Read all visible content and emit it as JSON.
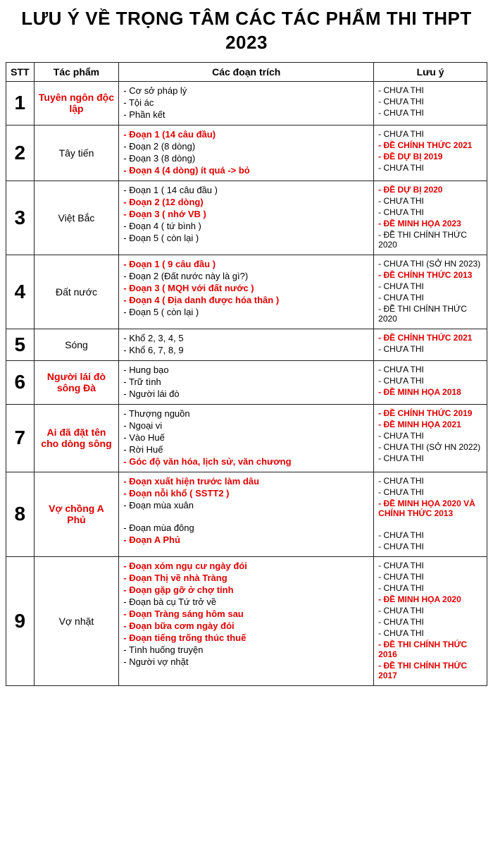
{
  "title": "LƯU Ý VỀ TRỌNG TÂM CÁC TÁC PHẨM THI THPT 2023",
  "header": {
    "stt": "STT",
    "tacpham": "Tác phẩm",
    "cac_doan_trich": "Các đoạn trích",
    "luu_y": "Lưu ý"
  },
  "rows": [
    {
      "stt": "1",
      "tacpham": "Tuyên ngôn độc lập",
      "tacpham_red": true,
      "doan": [
        {
          "text": "- Cơ sở pháp lý",
          "red": false
        },
        {
          "text": "- Tội ác",
          "red": false
        },
        {
          "text": "- Phần kết",
          "red": false
        }
      ],
      "luuy": [
        {
          "text": "- CHƯA THI",
          "red": false
        },
        {
          "text": "- CHƯA THI",
          "red": false
        },
        {
          "text": "- CHƯA THI",
          "red": false
        }
      ]
    },
    {
      "stt": "2",
      "tacpham": "Tây tiến",
      "tacpham_red": false,
      "doan": [
        {
          "text": "- Đoạn 1 (14 câu đầu)",
          "red": true
        },
        {
          "text": "- Đoạn 2 (8 dòng)",
          "red": false
        },
        {
          "text": "- Đoạn 3 (8 dòng)",
          "red": false
        },
        {
          "text": "- Đoạn 4 (4 dòng) ít quá -> bỏ",
          "red": true
        }
      ],
      "luuy": [
        {
          "text": "- CHƯA THI",
          "red": false
        },
        {
          "text": "- ĐỀ CHÍNH THỨC 2021",
          "red": true
        },
        {
          "text": "- ĐỀ DỰ BỊ 2019",
          "red": true
        },
        {
          "text": "- CHƯA THI",
          "red": false
        }
      ]
    },
    {
      "stt": "3",
      "tacpham": "Việt Bắc",
      "tacpham_red": false,
      "doan": [
        {
          "text": "- Đoạn 1 ( 14 câu đầu )",
          "red": false
        },
        {
          "text": "- Đoạn 2 (12 dòng)",
          "red": true
        },
        {
          "text": "- Đoạn 3 ( nhớ VB )",
          "red": true
        },
        {
          "text": "- Đoạn 4 ( tứ bình )",
          "red": false
        },
        {
          "text": "- Đoạn 5 ( còn lại )",
          "red": false
        }
      ],
      "luuy": [
        {
          "text": "- ĐỀ DỰ BỊ 2020",
          "red": true
        },
        {
          "text": "- CHƯA THI",
          "red": false
        },
        {
          "text": "- CHƯA THI",
          "red": false
        },
        {
          "text": "- ĐỀ MINH HỌA 2023",
          "red": true
        },
        {
          "text": "- ĐỀ THI CHÍNH THỨC 2020",
          "red": false
        }
      ]
    },
    {
      "stt": "4",
      "tacpham": "Đất nước",
      "tacpham_red": false,
      "doan": [
        {
          "text": "- Đoạn 1 ( 9 câu đầu )",
          "red": true
        },
        {
          "text": "- Đoạn 2 (Đất nước này là gì?)",
          "red": false
        },
        {
          "text": "- Đoạn 3 ( MQH với đất nước )",
          "red": true
        },
        {
          "text": "- Đoạn 4 ( Địa danh được hóa thân )",
          "red": true
        },
        {
          "text": "- Đoạn 5 ( còn lại )",
          "red": false
        }
      ],
      "luuy": [
        {
          "text": "- CHƯA THI (SỞ HN 2023)",
          "red": false
        },
        {
          "text": "- ĐỀ CHÍNH THỨC 2013",
          "red": true
        },
        {
          "text": "- CHƯA THI",
          "red": false
        },
        {
          "text": "- CHƯA THI",
          "red": false
        },
        {
          "text": "- ĐỀ THI CHÍNH THỨC 2020",
          "red": false
        }
      ]
    },
    {
      "stt": "5",
      "tacpham": "Sóng",
      "tacpham_red": false,
      "doan": [
        {
          "text": "- Khổ 2, 3, 4, 5",
          "red": false
        },
        {
          "text": "- Khổ 6, 7, 8, 9",
          "red": false
        }
      ],
      "luuy": [
        {
          "text": "- ĐỀ CHÍNH THỨC 2021",
          "red": true
        },
        {
          "text": "- CHƯA THI",
          "red": false
        }
      ]
    },
    {
      "stt": "6",
      "tacpham": "Người lái đò sông Đà",
      "tacpham_red": true,
      "doan": [
        {
          "text": "- Hung bạo",
          "red": false
        },
        {
          "text": "- Trữ tình",
          "red": false
        },
        {
          "text": "- Người lái đò",
          "red": false
        }
      ],
      "luuy": [
        {
          "text": "- CHƯA THI",
          "red": false
        },
        {
          "text": "- CHƯA THI",
          "red": false
        },
        {
          "text": "- ĐỀ MINH HỌA 2018",
          "red": true
        }
      ]
    },
    {
      "stt": "7",
      "tacpham": "Ai đã đặt tên cho dòng sông",
      "tacpham_red": true,
      "doan": [
        {
          "text": "- Thượng nguồn",
          "red": false
        },
        {
          "text": "- Ngoại vi",
          "red": false
        },
        {
          "text": "- Vào Huế",
          "red": false
        },
        {
          "text": "- Rời Huế",
          "red": false
        },
        {
          "text": "- Góc độ văn hóa, lịch sử, văn chương",
          "red": true
        }
      ],
      "luuy": [
        {
          "text": "- ĐỀ CHÍNH THỨC 2019",
          "red": true
        },
        {
          "text": "- ĐỀ MINH HỌA 2021",
          "red": true
        },
        {
          "text": "- CHƯA THI",
          "red": false
        },
        {
          "text": "- CHƯA THI (SỞ HN 2022)",
          "red": false
        },
        {
          "text": "- CHƯA THI",
          "red": false
        }
      ]
    },
    {
      "stt": "8",
      "tacpham": "Vợ chồng A Phủ",
      "tacpham_red": true,
      "doan": [
        {
          "text": "- Đoạn xuất hiện trước làm dâu",
          "red": true
        },
        {
          "text": "- Đoạn nỗi khổ ( SSTT2 )",
          "red": true
        },
        {
          "text": "- Đoạn mùa xuân",
          "red": false
        },
        {
          "text": "",
          "red": false
        },
        {
          "text": "- Đoạn mùa đông",
          "red": false
        },
        {
          "text": "- Đoạn A Phủ",
          "red": true
        }
      ],
      "luuy": [
        {
          "text": "- CHƯA THI",
          "red": false
        },
        {
          "text": "- CHƯA THI",
          "red": false
        },
        {
          "text": "- ĐỀ MINH HỌA 2020 VÀ CHÍNH THỨC 2013",
          "red": true
        },
        {
          "text": "",
          "red": false
        },
        {
          "text": "- CHƯA THI",
          "red": false
        },
        {
          "text": "- CHƯA THI",
          "red": false
        }
      ]
    },
    {
      "stt": "9",
      "tacpham": "Vợ nhặt",
      "tacpham_red": false,
      "doan": [
        {
          "text": "- Đoạn xóm ngụ cư ngày đói",
          "red": true
        },
        {
          "text": "- Đoạn Thị về nhà Tràng",
          "red": true
        },
        {
          "text": "- Đoạn gặp gỡ ở chợ tỉnh",
          "red": true
        },
        {
          "text": "- Đoạn bà cụ Tứ trở về",
          "red": false
        },
        {
          "text": "- Đoạn Tràng sáng hôm sau",
          "red": true
        },
        {
          "text": "- Đoạn bữa cơm ngày đói",
          "red": true
        },
        {
          "text": "- Đoạn tiếng trống thúc thuế",
          "red": true
        },
        {
          "text": "- Tình huống truyện",
          "red": false
        },
        {
          "text": "- Người vợ nhặt",
          "red": false
        }
      ],
      "luuy": [
        {
          "text": "- CHƯA THI",
          "red": false
        },
        {
          "text": "- CHƯA THI",
          "red": false
        },
        {
          "text": "- CHƯA THI",
          "red": false
        },
        {
          "text": "- ĐỀ MINH HỌA 2020",
          "red": true
        },
        {
          "text": "- CHƯA THI",
          "red": false
        },
        {
          "text": "- CHƯA THI",
          "red": false
        },
        {
          "text": "- CHƯA THI",
          "red": false
        },
        {
          "text": "- ĐỀ THI CHÍNH THỨC 2016",
          "red": true
        },
        {
          "text": "- ĐỀ THI CHÍNH THỨC 2017",
          "red": true
        }
      ]
    }
  ]
}
